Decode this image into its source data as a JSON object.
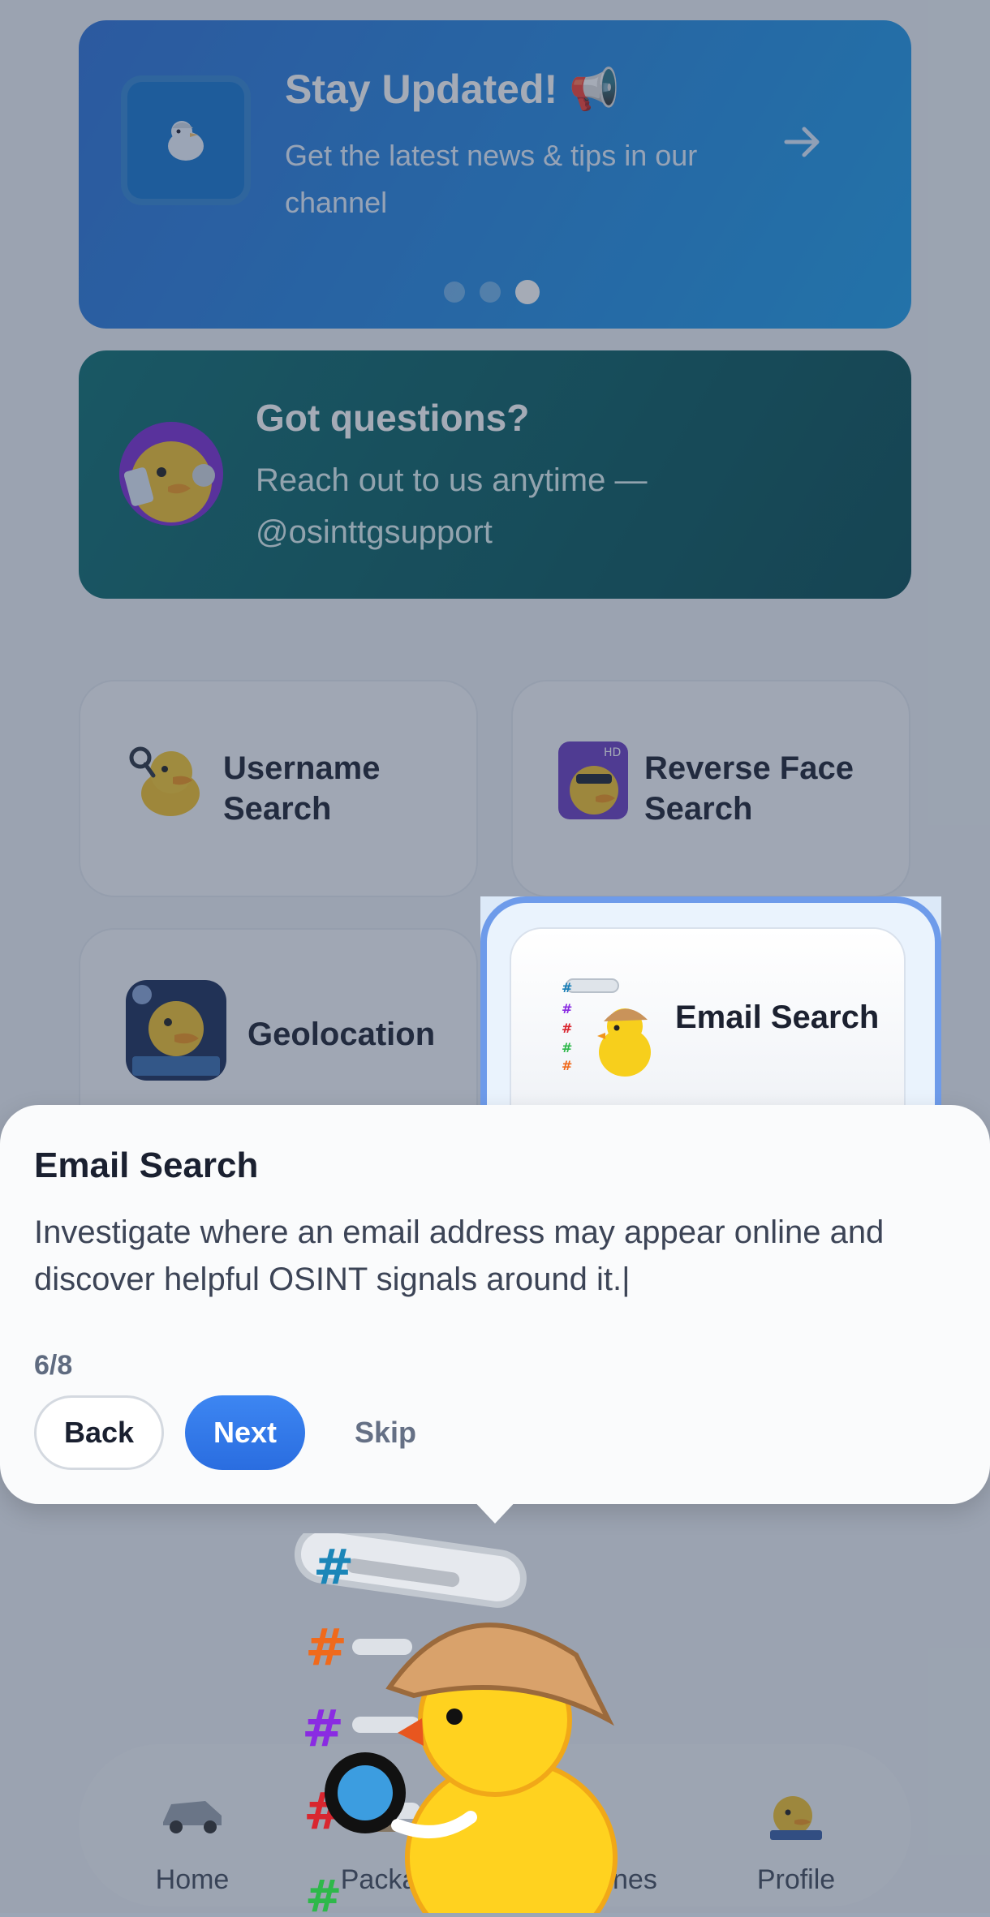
{
  "promo": {
    "title": "Stay Updated! 📢",
    "subtitle": "Get the latest news & tips in our channel",
    "dots": 3,
    "active_dot": 3
  },
  "support": {
    "title": "Got questions?",
    "subtitle": "Reach out to us anytime — @osinttgsupport"
  },
  "tools": [
    {
      "label": "Username Search",
      "icon": "duck-magnifier-icon"
    },
    {
      "label": "Reverse Face Search",
      "icon": "duck-face-scan-icon"
    },
    {
      "label": "Geolocation",
      "icon": "duck-map-icon"
    },
    {
      "label": "Email Search",
      "icon": "duck-detective-hashtag-icon"
    }
  ],
  "tooltip": {
    "title": "Email Search",
    "body": "Investigate where an email address may appear online and discover helpful OSINT signals around it.|",
    "step": "6/8",
    "back": "Back",
    "next": "Next",
    "skip": "Skip"
  },
  "nav": {
    "items": [
      {
        "label": "Home",
        "icon": "car-icon"
      },
      {
        "label": "Packa",
        "icon": "package-icon"
      },
      {
        "label": "nes",
        "icon": "games-icon"
      },
      {
        "label": "Profile",
        "icon": "duck-profile-icon"
      }
    ]
  },
  "colors": {
    "accent": "#2f78e8",
    "promo": "#1f9ee8",
    "support": "#0d6468",
    "overlay": "#5a6478"
  }
}
